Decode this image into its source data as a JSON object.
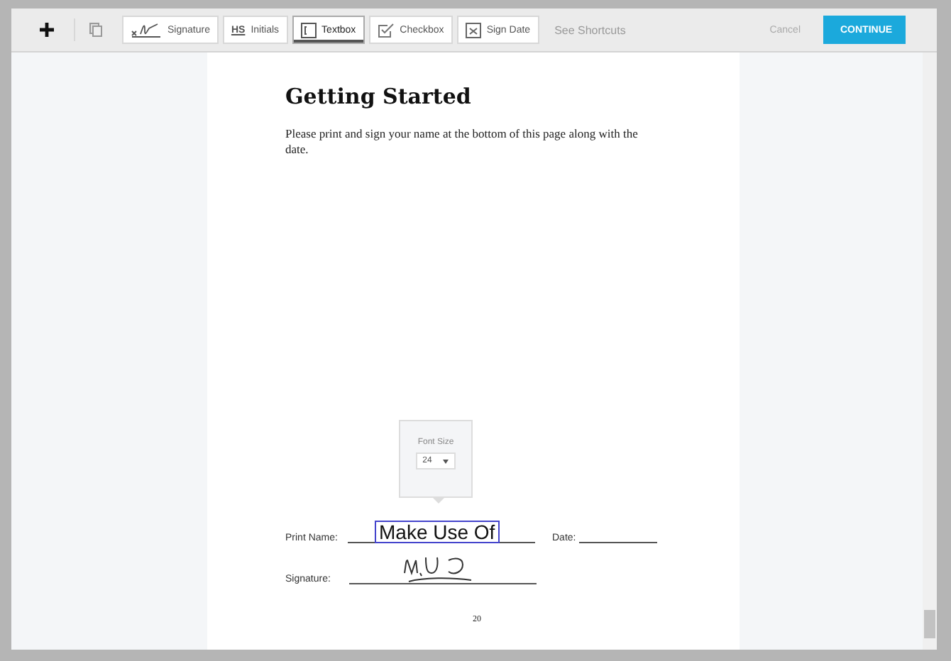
{
  "toolbar": {
    "tools": [
      {
        "kind": "signature",
        "label": "Signature",
        "selected": false
      },
      {
        "kind": "initials",
        "label": "Initials",
        "mark": "HS",
        "selected": false
      },
      {
        "kind": "textbox",
        "label": "Textbox",
        "selected": true
      },
      {
        "kind": "checkbox",
        "label": "Checkbox",
        "selected": false
      },
      {
        "kind": "date",
        "label": "Sign Date",
        "selected": false
      }
    ],
    "shortcuts_link": "See Shortcuts",
    "cancel": "Cancel",
    "continue": "CONTINUE"
  },
  "document": {
    "title": "Getting Started",
    "paragraph": "Please print and sign your name at the bottom of this page along with the date.",
    "font_popover": {
      "label": "Font Size",
      "value": "24"
    },
    "print_name": {
      "label": "Print Name:",
      "textbox": {
        "value": "Make Use Of",
        "selected": true
      }
    },
    "date": {
      "label": "Date:"
    },
    "signature": {
      "label": "Signature:"
    },
    "page_number": "20"
  }
}
